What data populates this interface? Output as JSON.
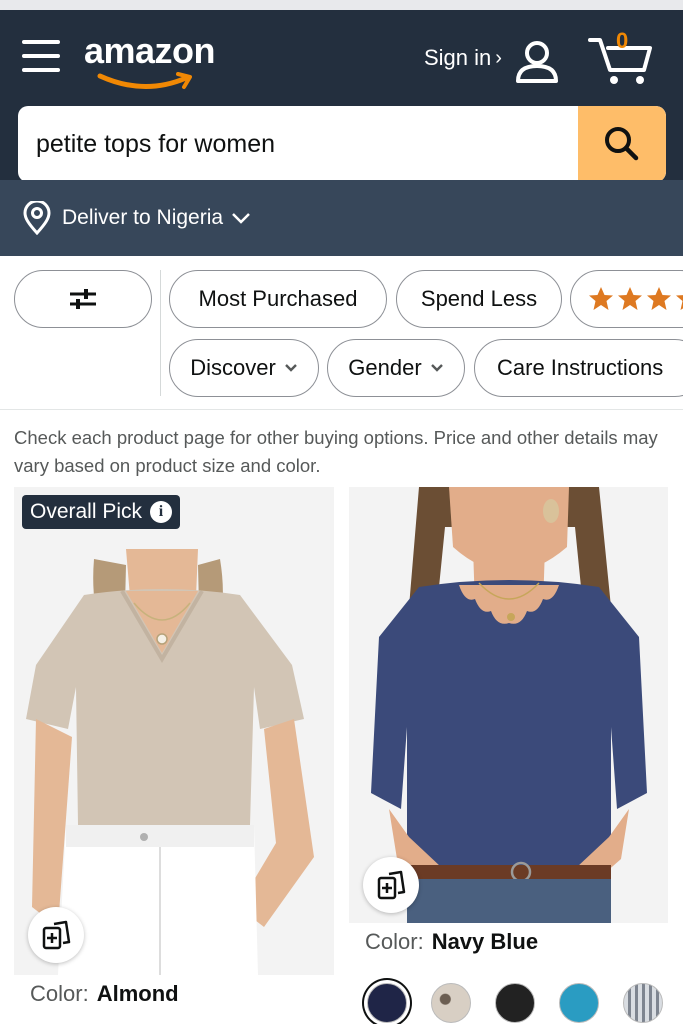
{
  "header": {
    "logo_text": "amazon",
    "signin_label": "Sign in",
    "signin_chevron": "›",
    "cart_count": "0"
  },
  "search": {
    "value": "petite tops for women",
    "icon": "search-icon"
  },
  "deliver": {
    "label": "Deliver to Nigeria"
  },
  "filters": {
    "row1": [
      "Most Purchased",
      "Spend Less"
    ],
    "row2": [
      "Discover",
      "Gender",
      "Care Instructions"
    ],
    "rating_icon": "star-rating-icon"
  },
  "notice": "Check each product page for other buying options. Price and other details may vary based on product size and color.",
  "products": [
    {
      "badge": "Overall Pick",
      "color_label": "Color:",
      "color_value": "Almond",
      "shirt_color": "#d2c5b5"
    },
    {
      "color_label": "Color:",
      "color_value": "Navy Blue",
      "shirt_color": "#3b4a7a",
      "swatches": [
        "#1f2547",
        "#c9beb2",
        "#222222",
        "#2a9cc2",
        "#9aa0a8"
      ]
    }
  ],
  "colors": {
    "header_bg": "#232f3e",
    "subheader_bg": "#37475a",
    "search_button": "#febd69",
    "cart_count": "#f08804",
    "star": "#de7921"
  }
}
